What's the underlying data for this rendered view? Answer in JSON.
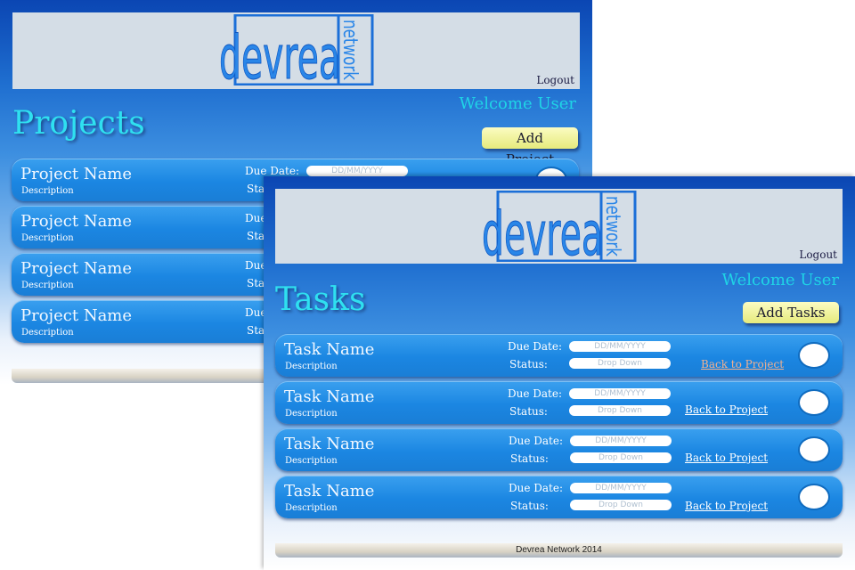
{
  "brand": {
    "logo_main": "devrea",
    "logo_side": "network"
  },
  "projects_window": {
    "logout": "Logout",
    "welcome": "Welcome User",
    "title": "Projects",
    "add_button": "Add Project",
    "due_label": "Due Date:",
    "status_label": "Status:",
    "date_placeholder": "DD/MM/YYYY",
    "items": [
      {
        "name": "Project Name",
        "description": "Description"
      },
      {
        "name": "Project Name",
        "description": "Description"
      },
      {
        "name": "Project Name",
        "description": "Description"
      },
      {
        "name": "Project Name",
        "description": "Description"
      }
    ]
  },
  "tasks_window": {
    "logout": "Logout",
    "welcome": "Welcome User",
    "title": "Tasks",
    "add_button": "Add Tasks",
    "due_label": "Due Date:",
    "status_label": "Status:",
    "date_placeholder": "DD/MM/YYYY",
    "status_placeholder": "Drop Down",
    "back_link": "Back to Project",
    "footer": "Devrea Network 2014",
    "items": [
      {
        "name": "Task Name",
        "description": "Description"
      },
      {
        "name": "Task Name",
        "description": "Description"
      },
      {
        "name": "Task Name",
        "description": "Description"
      },
      {
        "name": "Task Name",
        "description": "Description"
      }
    ]
  },
  "colors": {
    "title": "#2fe0f0",
    "card": "#1b86e2",
    "button": "#eef29a",
    "link_visited": "#f0b090"
  }
}
